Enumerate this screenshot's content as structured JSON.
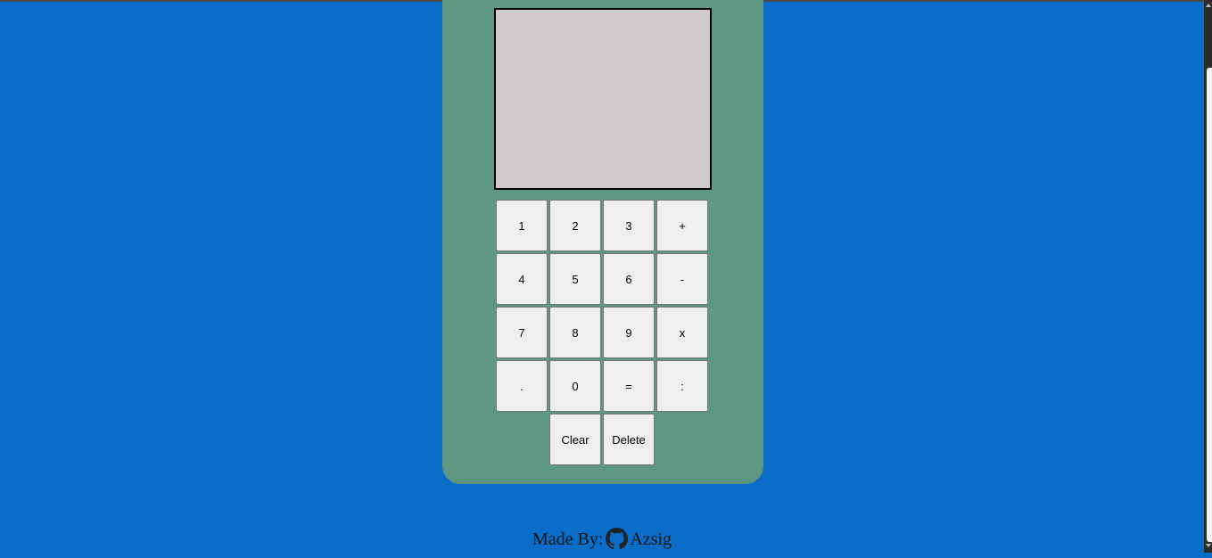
{
  "calculator": {
    "display": "",
    "keys": {
      "k1": "1",
      "k2": "2",
      "k3": "3",
      "plus": "+",
      "k4": "4",
      "k5": "5",
      "k6": "6",
      "minus": "-",
      "k7": "7",
      "k8": "8",
      "k9": "9",
      "times": "x",
      "dot": ".",
      "k0": "0",
      "equals": "=",
      "divide": ":",
      "clear": "Clear",
      "delete": "Delete"
    }
  },
  "footer": {
    "prefix": "Made By:",
    "icon": "github-icon",
    "author": "Azsig"
  },
  "colors": {
    "page_background": "#0a6ec8",
    "calculator_body": "#5e9882",
    "display_background": "#cfcbca",
    "key_background": "#efefef"
  }
}
